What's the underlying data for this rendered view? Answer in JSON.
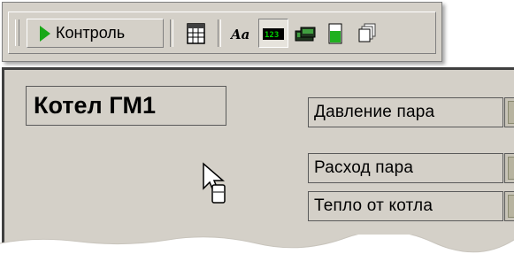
{
  "toolbar": {
    "control_label": "Контроль",
    "icons": [
      "play-icon",
      "table-icon",
      "font-icon",
      "numeric-display-icon",
      "digital-indicator-icon",
      "level-bar-icon",
      "copy-pages-icon"
    ],
    "active_icon": "numeric-display-icon"
  },
  "workspace": {
    "title": "Котел ГМ1",
    "params": [
      {
        "label": "Давление пара"
      },
      {
        "label": "Расход пара"
      },
      {
        "label": "Тепло от котла"
      }
    ]
  },
  "colors": {
    "panel": "#d4d0c8",
    "play_green": "#18a818",
    "display_green": "#00c000"
  }
}
